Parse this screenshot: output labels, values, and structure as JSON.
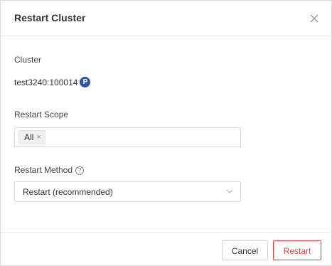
{
  "dialog": {
    "title": "Restart Cluster",
    "close_icon": "close-icon"
  },
  "cluster": {
    "label": "Cluster",
    "value": "test3240:100014",
    "badge": "P",
    "badge_color": "#2f5597"
  },
  "scope": {
    "label": "Restart Scope",
    "tags": [
      {
        "label": "All",
        "remove_icon": "×"
      }
    ]
  },
  "method": {
    "label": "Restart Method",
    "help_icon": "question-circle-icon",
    "selected": "Restart (recommended)",
    "dropdown_icon": "chevron-down-icon"
  },
  "footer": {
    "cancel_label": "Cancel",
    "restart_label": "Restart",
    "accent_color": "#e5393b"
  }
}
